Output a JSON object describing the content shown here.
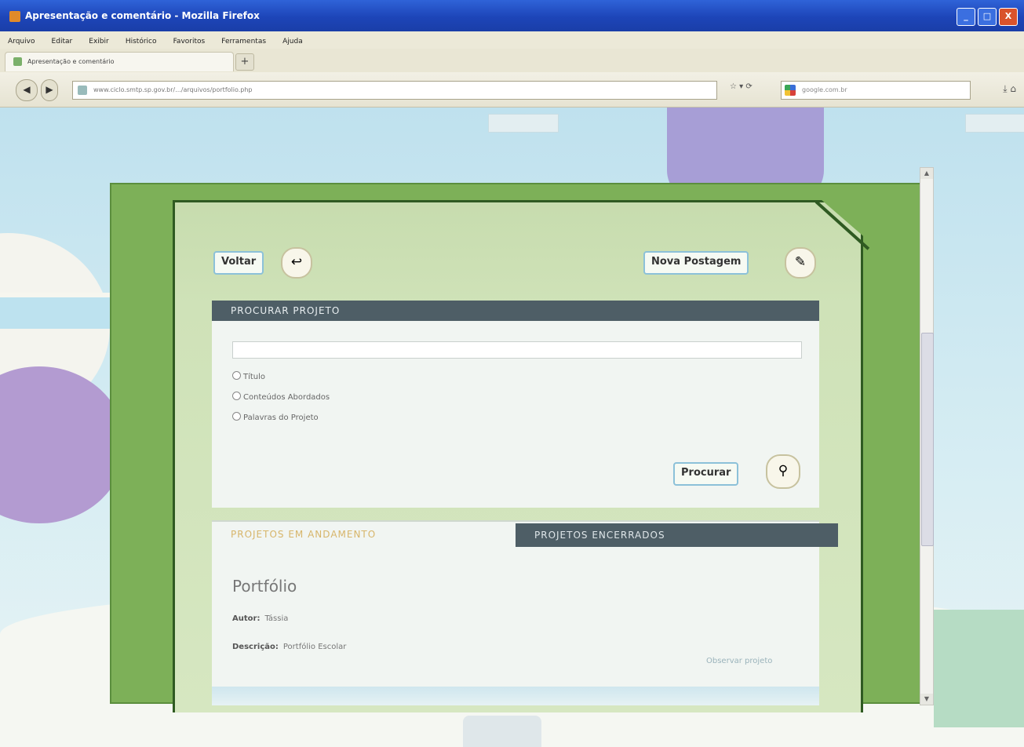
{
  "browser": {
    "title": "Apresentação e comentário - Mozilla Firefox",
    "menu": [
      "Arquivo",
      "Editar",
      "Exibir",
      "Histórico",
      "Favoritos",
      "Ferramentas",
      "Ajuda"
    ],
    "tab_label": "Apresentação e comentário",
    "url": "www.ciclo.smtp.sp.gov.br/.../arquivos/portfolio.php",
    "search_placeholder": "google.com.br",
    "window_buttons": [
      "_",
      "□",
      "X"
    ]
  },
  "app": {
    "back_label": "Voltar",
    "new_post_label": "Nova Postagem",
    "search_header": "PROCURAR PROJETO",
    "search_value": "",
    "radio_options": [
      "Título",
      "Conteúdos Abordados",
      "Palavras do Projeto"
    ],
    "search_button": "Procurar",
    "tab_running": "PROJETOS EM ANDAMENTO",
    "tab_closed": "PROJETOS ENCERRADOS",
    "project": {
      "title": "Portfólio",
      "author_label": "Autor:",
      "author": "Tássia",
      "description_label": "Descrição:",
      "description": "Portfólio Escolar",
      "link": "Observar projeto"
    }
  },
  "colors": {
    "frame_green": "#7db058",
    "dark_header": "#4e5e66",
    "accent_gold": "#d7b56a"
  }
}
